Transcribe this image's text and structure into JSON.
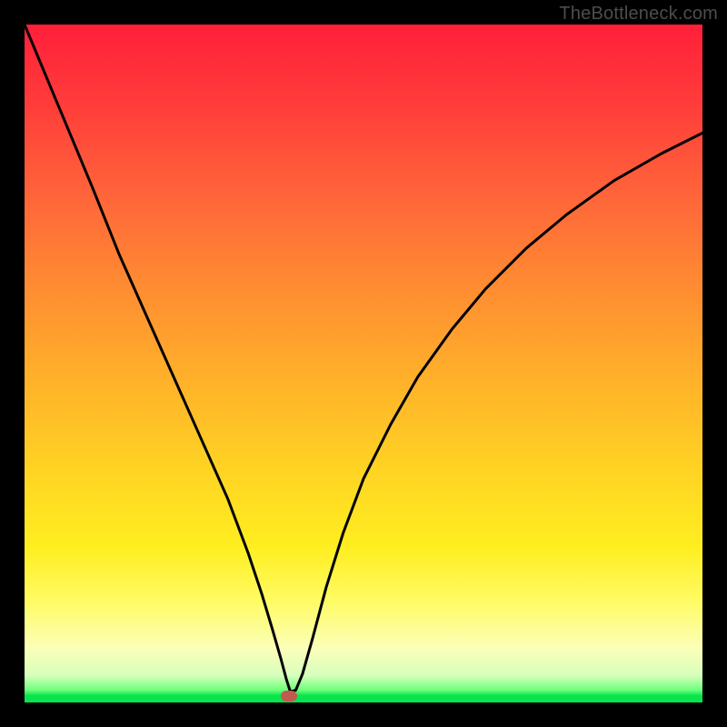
{
  "watermark": "TheBottleneck.com",
  "chart_data": {
    "type": "line",
    "title": "",
    "xlabel": "",
    "ylabel": "",
    "xlim": [
      0,
      100
    ],
    "ylim": [
      0,
      100
    ],
    "grid": false,
    "legend": false,
    "marker": {
      "x": 39,
      "y": 1
    },
    "series": [
      {
        "name": "curve",
        "color": "#000000",
        "x": [
          0,
          5,
          10,
          14,
          18,
          22,
          26,
          30,
          33,
          35,
          36.5,
          37.8,
          38.6,
          39.2,
          40.0,
          41.0,
          42.5,
          44.5,
          47,
          50,
          54,
          58,
          63,
          68,
          74,
          80,
          87,
          94,
          100
        ],
        "y": [
          100,
          88,
          76,
          66,
          57,
          48,
          39,
          30,
          22,
          16,
          11,
          6.5,
          3.5,
          1.6,
          1.8,
          4.2,
          9.5,
          17,
          25,
          33,
          41,
          48,
          55,
          61,
          67,
          72,
          77,
          81,
          84
        ]
      }
    ]
  },
  "colors": {
    "background": "#000000",
    "curve": "#000000",
    "marker": "#c15a4f"
  }
}
